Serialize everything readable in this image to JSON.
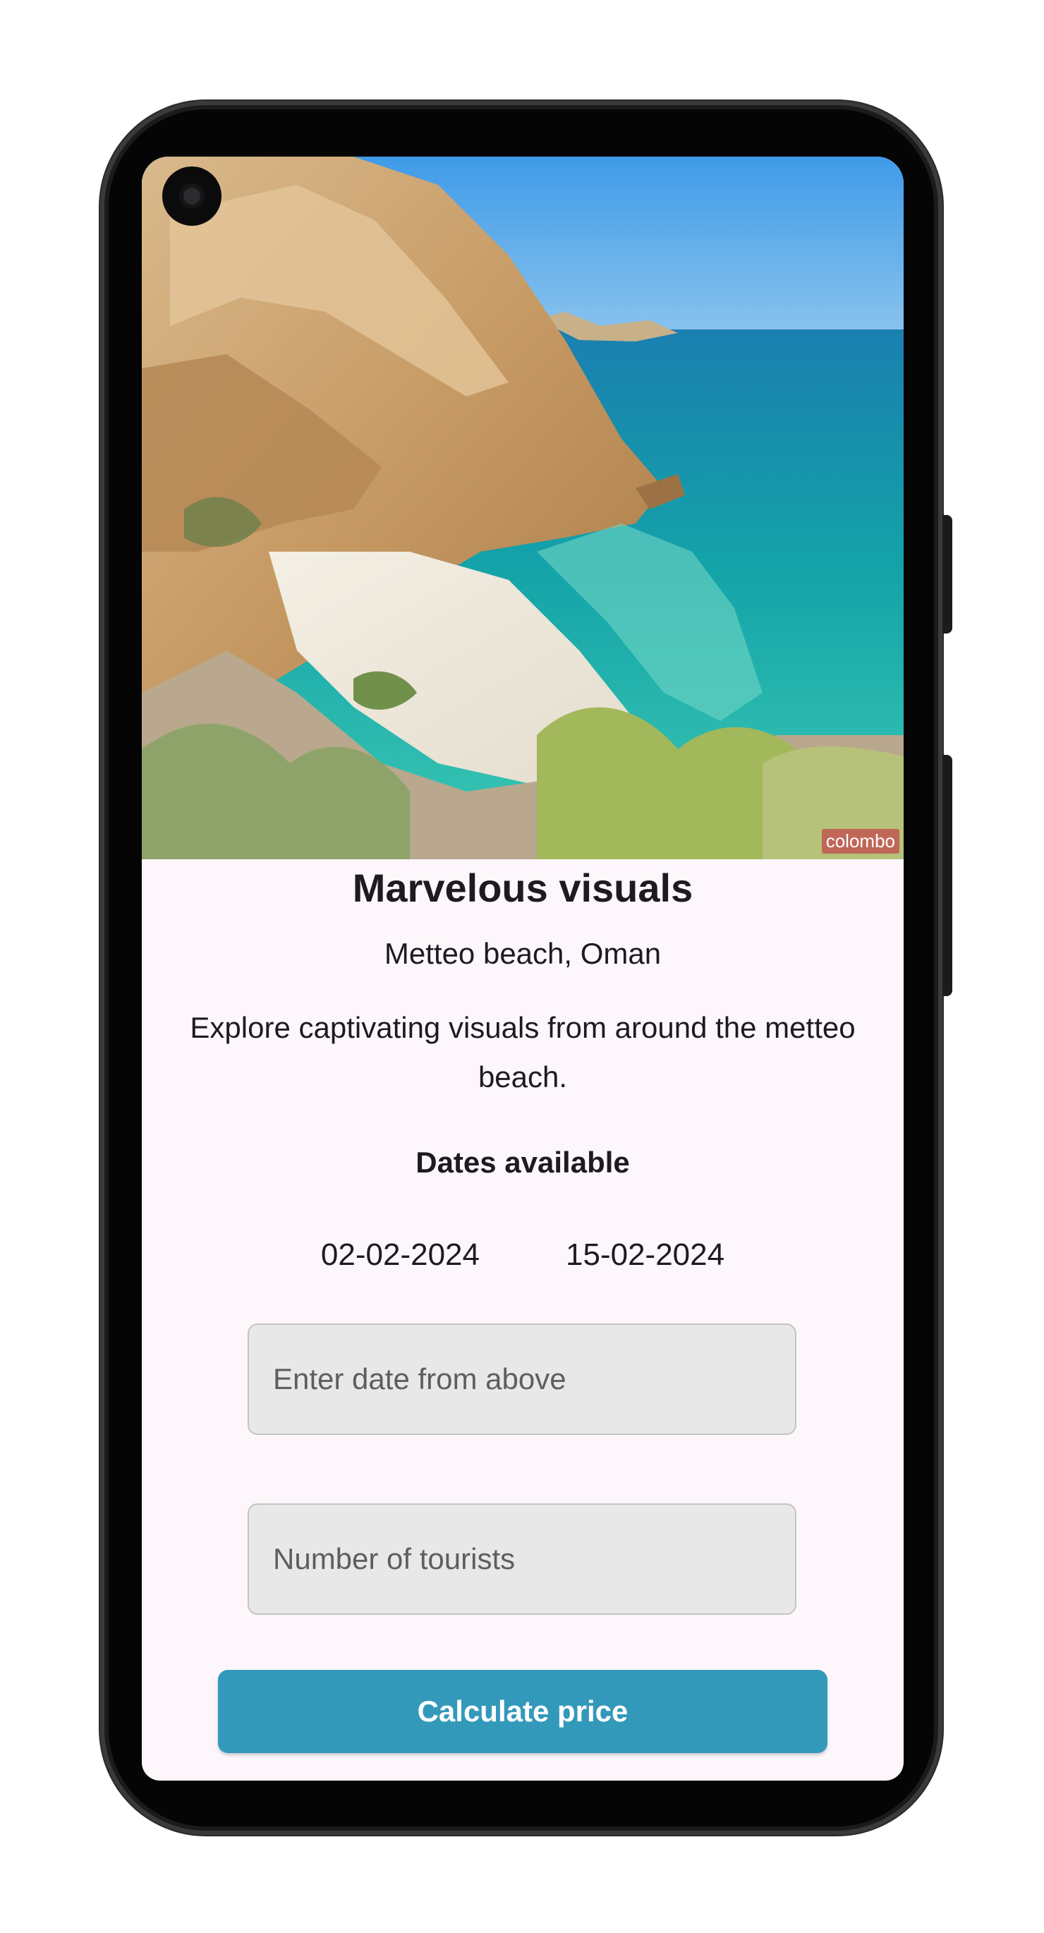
{
  "hero_image": {
    "alt_icon": "beach-photo",
    "watermark": "colombo"
  },
  "card": {
    "title": "Marvelous visuals",
    "location": "Metteo beach, Oman",
    "description": "Explore captivating visuals from around the metteo beach."
  },
  "dates": {
    "heading": "Dates available",
    "items": [
      "02-02-2024",
      "15-02-2024"
    ]
  },
  "form": {
    "date_placeholder": "Enter date from above",
    "tourists_placeholder": "Number of tourists",
    "submit_label": "Calculate price"
  },
  "colors": {
    "accent": "#3399bb",
    "background": "#fdf7fc",
    "field_background": "#e8e8e8"
  }
}
